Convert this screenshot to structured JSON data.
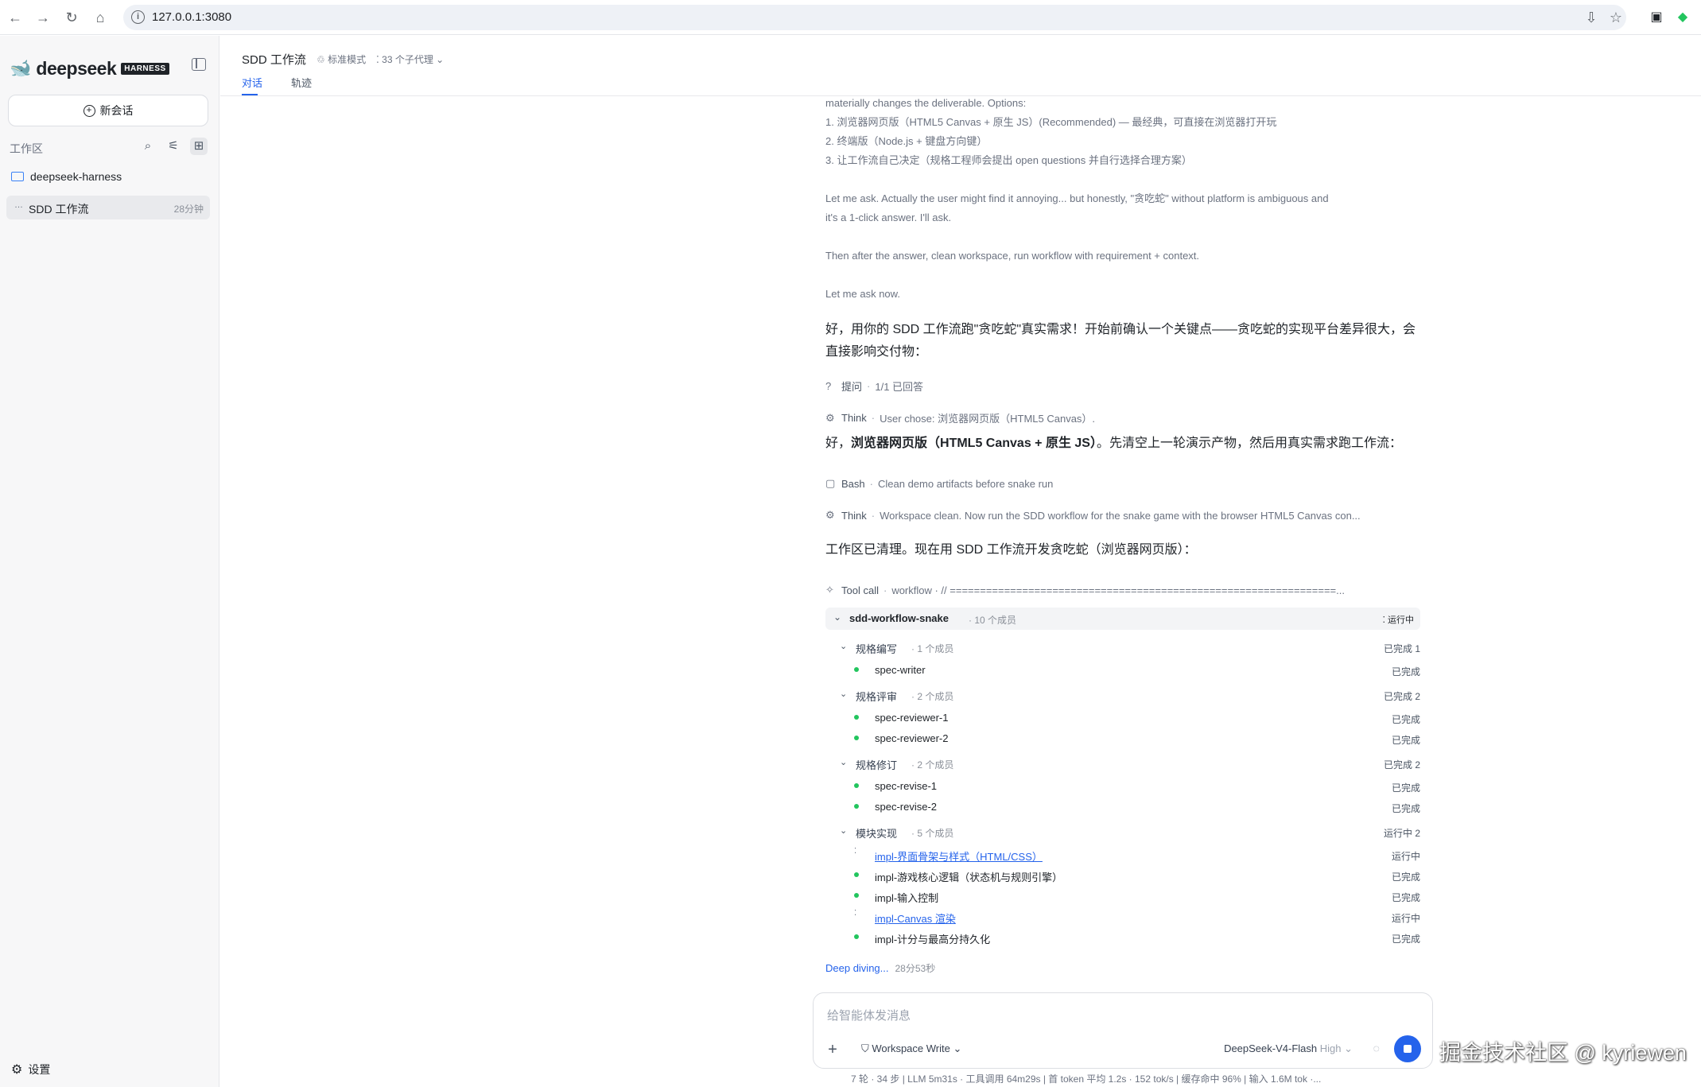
{
  "browser": {
    "url": "127.0.0.1:3080",
    "back_glyph": "←",
    "forward_glyph": "→",
    "reload_glyph": "↻",
    "home_glyph": "⌂",
    "info_glyph": "i",
    "install_glyph": "⇩",
    "star_glyph": "☆",
    "ext1_glyph": "▣",
    "ext2_glyph": "◆"
  },
  "sidebar": {
    "logo_glyph": "🐋",
    "brand": "deepseek",
    "brand_tag": "HARNESS",
    "new_chat": "新会话",
    "new_chat_glyph": "+",
    "workspace_label": "工作区",
    "tool_search": "⌕",
    "tool_filter": "⚟",
    "tool_add": "⊞",
    "folder": "deepseek-harness",
    "session": {
      "dots": "…",
      "title": "SDD 工作流",
      "age": "28分钟"
    },
    "settings": "设置",
    "settings_glyph": "⚙"
  },
  "header": {
    "title": "SDD 工作流",
    "mode": "♲ 标准模式",
    "agents": "⁚ 33 个子代理 ⌄",
    "tabs": [
      "对话",
      "轨迹"
    ]
  },
  "thinking_lines": [
    "materially changes the deliverable. Options:",
    "1. 浏览器网页版（HTML5 Canvas + 原生 JS）(Recommended) — 最经典，可直接在浏览器打开玩",
    "2. 终端版（Node.js + 键盘方向键）",
    "3. 让工作流自己决定（规格工程师会提出 open questions 并自行选择合理方案）",
    "Let me ask. Actually the user might find it annoying... but honestly, \"贪吃蛇\" without platform is ambiguous and",
    "it's a 1-click answer. I'll ask.",
    "Then after the answer, clean workspace, run workflow with requirement + context.",
    "Let me ask now."
  ],
  "messages": {
    "m1_line1": "好，用你的 SDD 工作流跑\"贪吃蛇\"真实需求！开始前确认一个关键点——贪吃蛇的实现平台差异很大，会",
    "m1_line2": "直接影响交付物：",
    "m2_prefix": "好，",
    "m2_bold": "浏览器网页版（HTML5 Canvas + 原生 JS）",
    "m2_suffix": "。先清空上一轮演示产物，然后用真实需求跑工作流：",
    "m3": "工作区已清理。现在用 SDD 工作流开发贪吃蛇（浏览器网页版）："
  },
  "steps": [
    {
      "icon": "?",
      "label": "提问",
      "desc": "1/1 已回答"
    },
    {
      "icon": "⚙",
      "label": "Think",
      "desc": "User chose: 浏览器网页版（HTML5 Canvas）."
    },
    {
      "icon": "▢",
      "label": "Bash",
      "desc": "Clean demo artifacts before snake run"
    },
    {
      "icon": "⚙",
      "label": "Think",
      "desc": "Workspace clean. Now run the SDD workflow for the snake game with the browser HTML5 Canvas con..."
    },
    {
      "icon": "✧",
      "label": "Tool call",
      "desc": "workflow · // ================================================================..."
    }
  ],
  "workflow": {
    "chevron": "⌄",
    "name": "sdd-workflow-snake",
    "count": "· 10 个成员",
    "status": "⁚ 运行中",
    "groups": [
      {
        "name": "规格编写",
        "count": "· 1 个成员",
        "status": "已完成 1"
      },
      {
        "name": "规格评审",
        "count": "· 2 个成员",
        "status": "已完成 2"
      },
      {
        "name": "规格修订",
        "count": "· 2 个成员",
        "status": "已完成 2"
      },
      {
        "name": "模块实现",
        "count": "· 5 个成员",
        "status": "运行中 2"
      }
    ],
    "members": [
      {
        "name": "spec-writer",
        "status": "已完成"
      },
      {
        "name": "spec-reviewer-1",
        "status": "已完成"
      },
      {
        "name": "spec-reviewer-2",
        "status": "已完成"
      },
      {
        "name": "spec-revise-1",
        "status": "已完成"
      },
      {
        "name": "spec-revise-2",
        "status": "已完成"
      },
      {
        "name": "impl-界面骨架与样式（HTML/CSS）",
        "status": "运行中"
      },
      {
        "name": "impl-游戏核心逻辑（状态机与规则引擎）",
        "status": "已完成"
      },
      {
        "name": "impl-输入控制",
        "status": "已完成"
      },
      {
        "name": "impl-Canvas 渲染",
        "status": "运行中"
      },
      {
        "name": "impl-计分与最高分持久化",
        "status": "已完成"
      }
    ],
    "spinner": "⁚"
  },
  "deep": {
    "label": "Deep diving...",
    "time": "28分53秒"
  },
  "composer": {
    "placeholder": "给智能体发消息",
    "add_glyph": "+",
    "workspace": "⛉ Workspace Write ⌄",
    "model": "DeepSeek-V4-Flash",
    "level": "High ⌄",
    "loading_glyph": "◌"
  },
  "statusbar": "7 轮 · 34 步   |   LLM 5m31s · 工具调用 64m29s   |   首 token 平均 1.2s · 152 tok/s   |   缓存命中 96%   |   输入 1.6M tok ·...",
  "watermark": "掘金技术社区 @ kyriewen",
  "colors": {
    "accent": "#2563eb",
    "done": "#22c55e"
  }
}
